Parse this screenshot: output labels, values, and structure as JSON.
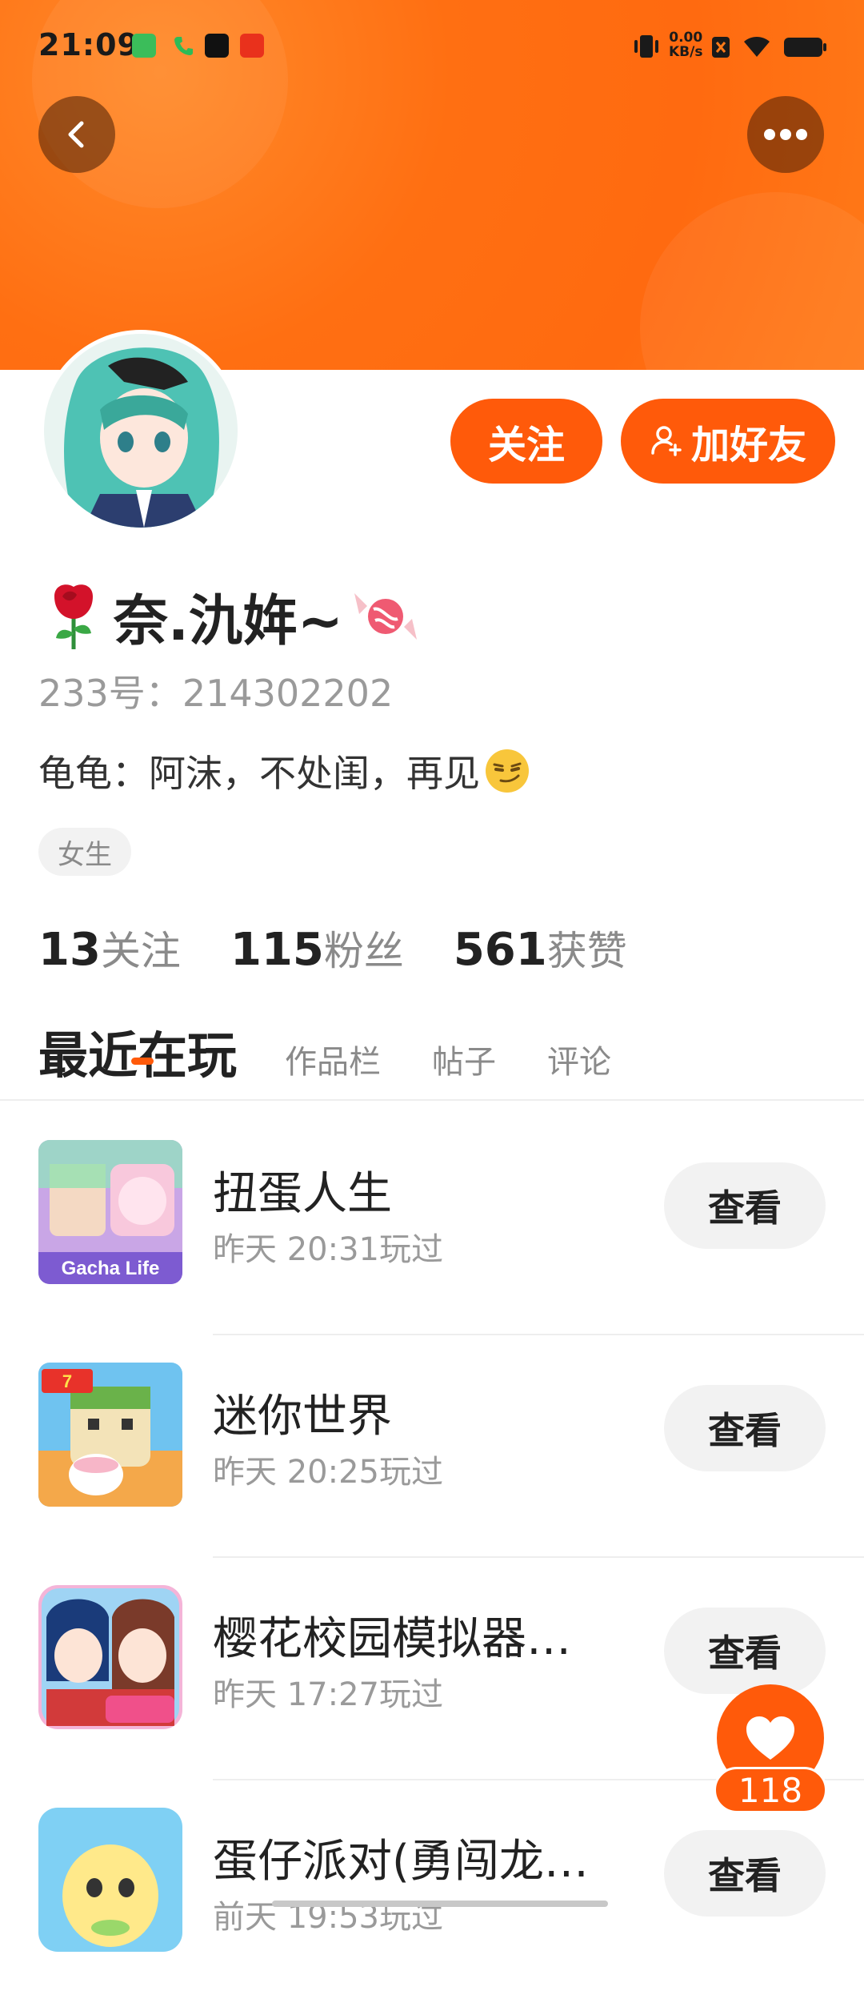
{
  "status_bar": {
    "time": "21:09",
    "net_speed": "0.00",
    "net_unit": "KB/s"
  },
  "profile": {
    "name": "奈.氿姩~",
    "uid_label": "233号：",
    "uid": "214302202",
    "bio": "龟龟：阿沫，不处闺，再见",
    "tag": "女生"
  },
  "actions": {
    "follow": "关注",
    "add_friend": "加好友"
  },
  "stats": [
    {
      "num": "13",
      "label": "关注"
    },
    {
      "num": "115",
      "label": "粉丝"
    },
    {
      "num": "561",
      "label": "获赞"
    }
  ],
  "tabs": [
    {
      "label": "最近在玩"
    },
    {
      "label": "作品栏"
    },
    {
      "label": "帖子"
    },
    {
      "label": "评论"
    }
  ],
  "games": [
    {
      "title": "扭蛋人生",
      "time": "昨天 20:31玩过",
      "button": "查看"
    },
    {
      "title": "迷你世界",
      "time": "昨天 20:25玩过",
      "button": "查看"
    },
    {
      "title": "樱花校园模拟器…",
      "time": "昨天 17:27玩过",
      "button": "查看"
    },
    {
      "title": "蛋仔派对(勇闯龙…",
      "time": "前天 19:53玩过",
      "button": "查看"
    }
  ],
  "like": {
    "count": "118"
  },
  "colors": {
    "accent": "#ff5a0a",
    "header": "#ff6f12"
  }
}
